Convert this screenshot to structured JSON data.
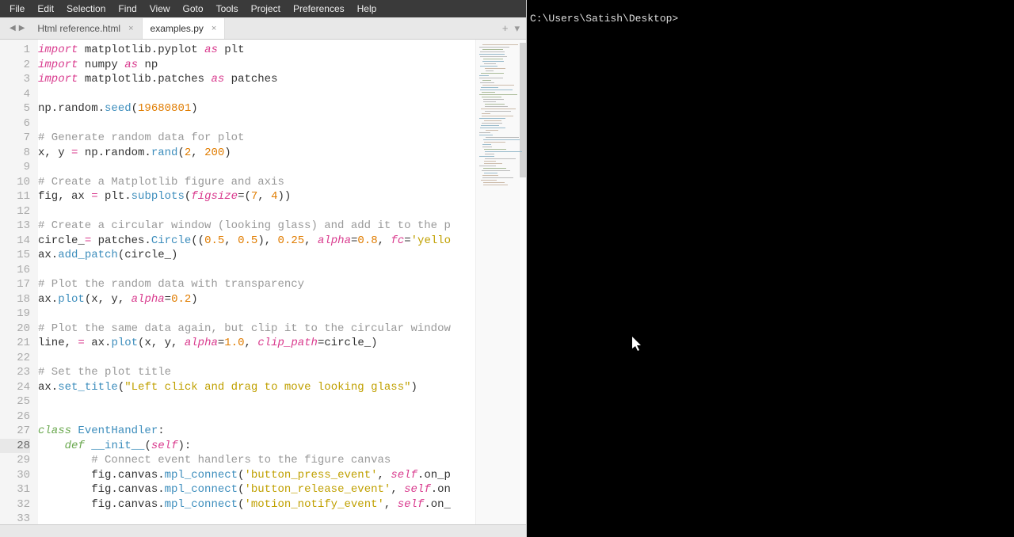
{
  "menu": [
    "File",
    "Edit",
    "Selection",
    "Find",
    "View",
    "Goto",
    "Tools",
    "Project",
    "Preferences",
    "Help"
  ],
  "tabs": [
    {
      "label": "Html reference.html",
      "active": false
    },
    {
      "label": "examples.py",
      "active": true
    }
  ],
  "terminal": {
    "prompt": "C:\\Users\\Satish\\Desktop>"
  },
  "code": {
    "lines": [
      {
        "n": 1,
        "html": "<span class='kw'>import</span> matplotlib.pyplot <span class='kw'>as</span> plt"
      },
      {
        "n": 2,
        "html": "<span class='kw'>import</span> numpy <span class='kw'>as</span> np"
      },
      {
        "n": 3,
        "html": "<span class='kw'>import</span> matplotlib.patches <span class='kw'>as</span> patches"
      },
      {
        "n": 4,
        "html": ""
      },
      {
        "n": 5,
        "html": "np.random.<span class='func'>seed</span>(<span class='num'>19680801</span>)"
      },
      {
        "n": 6,
        "html": ""
      },
      {
        "n": 7,
        "html": "<span class='comm'># Generate random data for plot</span>"
      },
      {
        "n": 8,
        "html": "x, y <span class='kw'>=</span> np.random.<span class='func'>rand</span>(<span class='num'>2</span>, <span class='num'>200</span>)"
      },
      {
        "n": 9,
        "html": ""
      },
      {
        "n": 10,
        "html": "<span class='comm'># Create a Matplotlib figure and axis</span>"
      },
      {
        "n": 11,
        "html": "fig, ax <span class='kw'>=</span> plt.<span class='func'>subplots</span>(<span class='self'>figsize</span>=(<span class='num'>7</span>, <span class='num'>4</span>))"
      },
      {
        "n": 12,
        "html": ""
      },
      {
        "n": 13,
        "html": "<span class='comm'># Create a circular window (looking glass) and add it to the p</span>"
      },
      {
        "n": 14,
        "html": "circle_<span class='kw'>=</span> patches.<span class='func'>Circle</span>((<span class='num'>0.5</span>, <span class='num'>0.5</span>), <span class='num'>0.25</span>, <span class='self'>alpha</span>=<span class='num'>0.8</span>, <span class='self'>fc</span>=<span class='str'>'yello</span>"
      },
      {
        "n": 15,
        "html": "ax.<span class='func'>add_patch</span>(circle_)"
      },
      {
        "n": 16,
        "html": ""
      },
      {
        "n": 17,
        "html": "<span class='comm'># Plot the random data with transparency</span>"
      },
      {
        "n": 18,
        "html": "ax.<span class='func'>plot</span>(x, y, <span class='self'>alpha</span>=<span class='num'>0.2</span>)"
      },
      {
        "n": 19,
        "html": ""
      },
      {
        "n": 20,
        "html": "<span class='comm'># Plot the same data again, but clip it to the circular window</span>"
      },
      {
        "n": 21,
        "html": "line, <span class='kw'>=</span> ax.<span class='func'>plot</span>(x, y, <span class='self'>alpha</span>=<span class='num'>1.0</span>, <span class='self'>clip_path</span>=circle_)"
      },
      {
        "n": 22,
        "html": ""
      },
      {
        "n": 23,
        "html": "<span class='comm'># Set the plot title</span>"
      },
      {
        "n": 24,
        "html": "ax.<span class='func'>set_title</span>(<span class='str'>\"Left click and drag to move looking glass\"</span>)"
      },
      {
        "n": 25,
        "html": ""
      },
      {
        "n": 26,
        "html": ""
      },
      {
        "n": 27,
        "html": "<span class='cls'>class</span> <span class='func'>EventHandler</span>:"
      },
      {
        "n": 28,
        "html": "    <span class='cls'>def</span> <span class='func'>__init__</span>(<span class='self'>self</span>):",
        "current": true
      },
      {
        "n": 29,
        "html": "        <span class='comm'># Connect event handlers to the figure canvas</span>"
      },
      {
        "n": 30,
        "html": "        fig.canvas.<span class='func'>mpl_connect</span>(<span class='str'>'button_press_event'</span>, <span class='self'>self</span>.on_p"
      },
      {
        "n": 31,
        "html": "        fig.canvas.<span class='func'>mpl_connect</span>(<span class='str'>'button_release_event'</span>, <span class='self'>self</span>.on"
      },
      {
        "n": 32,
        "html": "        fig.canvas.<span class='func'>mpl_connect</span>(<span class='str'>'motion_notify_event'</span>, <span class='self'>self</span>.on_"
      },
      {
        "n": 33,
        "html": ""
      }
    ]
  }
}
